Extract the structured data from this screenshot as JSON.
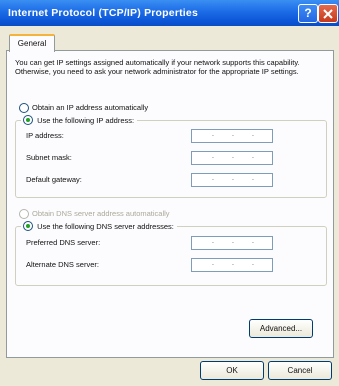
{
  "window": {
    "title": "Internet Protocol (TCP/IP) Properties",
    "help_glyph": "?",
    "close_glyph": "✕"
  },
  "tabs": [
    {
      "label": "General"
    }
  ],
  "description": "You can get IP settings assigned automatically if your network supports this capability. Otherwise, you need to ask your network administrator for the appropriate IP settings.",
  "ip": {
    "auto_label": "Obtain an IP address automatically",
    "manual_label": "Use the following IP address:",
    "fields": [
      {
        "label": "IP address:"
      },
      {
        "label": "Subnet mask:"
      },
      {
        "label": "Default gateway:"
      }
    ]
  },
  "dns": {
    "auto_label": "Obtain DNS server address automatically",
    "manual_label": "Use the following DNS server addresses:",
    "fields": [
      {
        "label": "Preferred DNS server:"
      },
      {
        "label": "Alternate DNS server:"
      }
    ]
  },
  "ip_placeholder_dot": ".",
  "buttons": {
    "advanced": "Advanced...",
    "ok": "OK",
    "cancel": "Cancel"
  },
  "colors": {
    "titlebar": "#0c56d8",
    "dialog_bg": "#ece9d8",
    "tab_highlight": "#f5b33b",
    "radio_dot": "#21a121",
    "close_button": "#c6391a"
  }
}
